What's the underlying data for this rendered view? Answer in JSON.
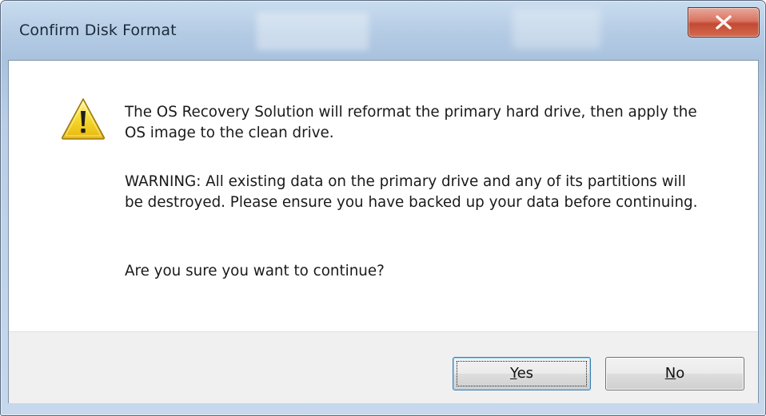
{
  "window": {
    "title": "Confirm Disk Format",
    "close_icon": "close-icon"
  },
  "dialog": {
    "icon": "warning-icon",
    "message_1": "The OS Recovery Solution will reformat the primary hard drive, then apply the OS image to the clean drive.",
    "message_2": "WARNING: All existing data on the primary drive and any of its partitions will be destroyed. Please ensure you have backed up your data before continuing.",
    "message_3": "Are you sure you want to continue?"
  },
  "buttons": {
    "yes": {
      "mnemonic": "Y",
      "rest": "es"
    },
    "no": {
      "mnemonic": "N",
      "rest": "o"
    }
  },
  "colors": {
    "close_button": "#c24a33",
    "warning_yellow": "#f5d327",
    "focus_border": "#3c7fb1"
  }
}
